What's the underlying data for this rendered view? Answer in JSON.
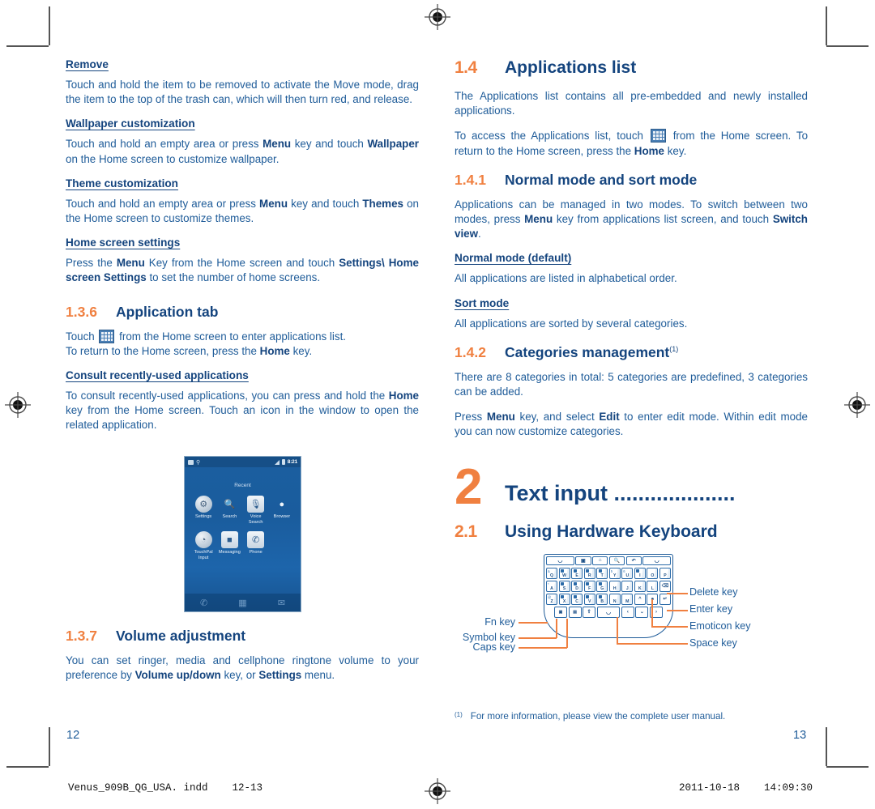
{
  "document": {
    "colors": {
      "body_blue": "#1F5C99",
      "heading_blue": "#14447E",
      "accent_orange": "#F08040"
    },
    "left_page_number": "12",
    "right_page_number": "13"
  },
  "left_column": {
    "sections": [
      {
        "type": "subhead",
        "title": "Remove",
        "body": "Touch and hold the item to be removed to activate the Move mode, drag the item to the top of the trash can, which will then turn red, and release."
      },
      {
        "type": "subhead",
        "title": "Wallpaper customization",
        "body_parts": [
          {
            "t": "Touch and hold an empty area or press ",
            "b": false
          },
          {
            "t": "Menu",
            "b": true
          },
          {
            "t": " key and touch ",
            "b": false
          },
          {
            "t": "Wallpaper",
            "b": true
          },
          {
            "t": " on the Home screen to customize wallpaper.",
            "b": false
          }
        ]
      },
      {
        "type": "subhead",
        "title": "Theme customization",
        "body_parts": [
          {
            "t": "Touch and hold an empty area or press ",
            "b": false
          },
          {
            "t": "Menu",
            "b": true
          },
          {
            "t": " key and touch ",
            "b": false
          },
          {
            "t": "Themes",
            "b": true
          },
          {
            "t": " on the Home screen to customize themes.",
            "b": false
          }
        ]
      },
      {
        "type": "subhead",
        "title": "Home screen settings",
        "body_parts": [
          {
            "t": "Press the ",
            "b": false
          },
          {
            "t": "Menu",
            "b": true
          },
          {
            "t": " Key from the Home screen and touch ",
            "b": false
          },
          {
            "t": "Settings\\",
            "b": true
          },
          {
            "t": " ",
            "b": false
          },
          {
            "t": "Home screen Settings",
            "b": true
          },
          {
            "t": " to set the number of home screens.",
            "b": false
          }
        ]
      }
    ],
    "heading_136": {
      "num": "1.3.6",
      "title": "Application tab"
    },
    "app_tab_body_a": "Touch ",
    "app_tab_body_b": " from the Home screen to enter applications list.",
    "app_tab_body_c1": "To return to the Home screen, press the ",
    "app_tab_body_c2": "Home",
    "app_tab_body_c3": " key.",
    "consult_heading": "Consult recently-used applications",
    "consult_parts": [
      {
        "t": "To consult recently-used applications, you can press and hold the ",
        "b": false
      },
      {
        "t": "Home",
        "b": true
      },
      {
        "t": " key from the Home screen. Touch an icon in the window to open the related application.",
        "b": false
      }
    ],
    "heading_137": {
      "num": "1.3.7",
      "title": "Volume adjustment"
    },
    "volume_parts": [
      {
        "t": "You can set ringer, media and cellphone ringtone volume to your preference by ",
        "b": false
      },
      {
        "t": "Volume up/down",
        "b": true
      },
      {
        "t": " key, or ",
        "b": false
      },
      {
        "t": "Settings",
        "b": true
      },
      {
        "t": " menu.",
        "b": false
      }
    ]
  },
  "phone_screenshot": {
    "status_time": "8:21",
    "window_title": "Recent",
    "apps": [
      {
        "label": "Settings",
        "icon": "settings-icon",
        "glyph": "⚙",
        "style": "round"
      },
      {
        "label": "Search",
        "icon": "search-icon",
        "glyph": "🔍",
        "style": "plain"
      },
      {
        "label": "Voice Search",
        "icon": "microphone-icon",
        "glyph": "🎙",
        "style": "sq"
      },
      {
        "label": "Browser",
        "icon": "globe-icon",
        "glyph": "●",
        "style": "plain"
      },
      {
        "label": "TouchPal Input",
        "icon": "touchpal-icon",
        "glyph": "◔",
        "style": "round"
      },
      {
        "label": "Messaging",
        "icon": "message-icon",
        "glyph": "■",
        "style": "sq"
      },
      {
        "label": "Phone",
        "icon": "phone-icon",
        "glyph": "✆",
        "style": "sq"
      }
    ],
    "dock": [
      {
        "icon": "dock-phone-icon",
        "glyph": "✆"
      },
      {
        "icon": "dock-apps-icon",
        "glyph": "▦"
      },
      {
        "icon": "dock-mail-icon",
        "glyph": "✉"
      }
    ]
  },
  "right_column": {
    "heading_14": {
      "num": "1.4",
      "title": "Applications list"
    },
    "intro": "The Applications list contains all pre-embedded and newly installed applications.",
    "access_a": "To access the Applications list, touch ",
    "access_b": " from the Home screen. To return to the Home screen, press the ",
    "access_c": "Home",
    "access_d": " key.",
    "heading_141": {
      "num": "1.4.1",
      "title": "Normal mode and sort mode"
    },
    "modes_parts": [
      {
        "t": "Applications can be managed in two modes. To switch between two modes, press ",
        "b": false
      },
      {
        "t": "Menu",
        "b": true
      },
      {
        "t": " key from applications list screen, and touch ",
        "b": false
      },
      {
        "t": "Switch view",
        "b": true
      },
      {
        "t": ".",
        "b": false
      }
    ],
    "normal_mode_heading": "Normal mode (default)",
    "normal_mode_body": "All applications are listed in alphabetical order.",
    "sort_mode_heading": "Sort mode",
    "sort_mode_body": "All applications are sorted by several categories.",
    "heading_142": {
      "num": "1.4.2",
      "title": "Categories management",
      "footnote": "(1)"
    },
    "categories_body": "There are 8 categories in total: 5 categories are predefined, 3 categories can be added.",
    "edit_parts": [
      {
        "t": "Press ",
        "b": false
      },
      {
        "t": "Menu",
        "b": true
      },
      {
        "t": " key, and select ",
        "b": false
      },
      {
        "t": "Edit",
        "b": true
      },
      {
        "t": " to enter edit mode. Within edit mode you can now customize categories.",
        "b": false
      }
    ],
    "chapter": {
      "num": "2",
      "title": "Text input ...................."
    },
    "heading_21": {
      "num": "2.1",
      "title": "Using Hardware Keyboard"
    }
  },
  "keyboard": {
    "function_row": [
      "call-key",
      "menu-key",
      "home-key",
      "search-key",
      "back-key",
      "end-call-key"
    ],
    "rows": [
      [
        "Q",
        "W",
        "E",
        "R",
        "T",
        "Y",
        "U",
        "I",
        "O",
        "P"
      ],
      [
        "A",
        "S",
        "D",
        "F",
        "G",
        "H",
        "J",
        "K",
        "L",
        "del"
      ],
      [
        "Z",
        "X",
        "C",
        "V",
        "B",
        "N",
        "M",
        "up",
        "emot",
        "enter"
      ],
      [
        "fn",
        "sym",
        "caps",
        "space",
        "left",
        "down",
        "right"
      ]
    ],
    "alt_row1": [
      "&",
      "1",
      "2",
      "3",
      "4",
      "5",
      "6",
      "7",
      "8",
      "9"
    ],
    "alt_row2": [
      "*",
      "#",
      "+",
      "-",
      "=",
      "_",
      "/",
      ":",
      ";",
      ""
    ],
    "alt_row3": [
      "@",
      "'",
      "\"",
      "?",
      "!",
      ",",
      ".",
      "",
      "",
      ""
    ],
    "callouts_right": [
      {
        "label": "Delete key",
        "name": "delete-key-callout"
      },
      {
        "label": "Enter key",
        "name": "enter-key-callout"
      },
      {
        "label": "Emoticon key",
        "name": "emoticon-key-callout"
      },
      {
        "label": "Space key",
        "name": "space-key-callout"
      }
    ],
    "callouts_left": [
      {
        "label": "Fn key",
        "name": "fn-key-callout"
      },
      {
        "label": "Symbol key",
        "name": "symbol-key-callout"
      },
      {
        "label": "Caps key",
        "name": "caps-key-callout"
      }
    ]
  },
  "footnote": {
    "marker": "(1)",
    "text": "For more information, please view the complete user manual."
  },
  "print_slug": {
    "file": "Venus_909B_QG_USA. indd    12-13",
    "date": "2011-10-18    14:09:30"
  }
}
